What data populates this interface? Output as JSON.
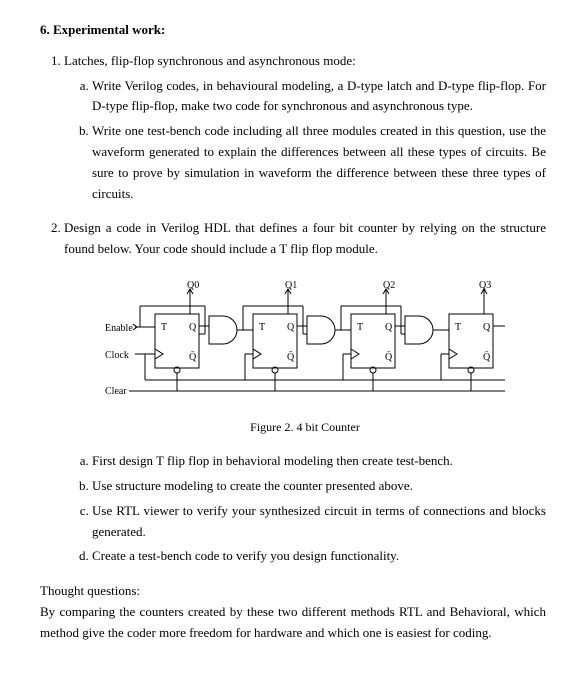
{
  "section": {
    "number": "6.",
    "title": "Experimental work:"
  },
  "q1": {
    "text": "Latches, flip-flop synchronous and asynchronous mode:",
    "a": "Write Verilog codes, in behavioural modeling, a D-type latch and D-type flip-flop. For D-type flip-flop, make two code for synchronous and asynchronous type.",
    "b": "Write one test-bench code including all three modules created in this question, use the waveform generated to explain the differences between all these types of circuits. Be sure to prove by simulation in waveform the difference between these three types of circuits."
  },
  "q2": {
    "text": "Design a code in Verilog HDL that defines a four bit counter by relying on the structure found below. Your code should include a T flip flop module.",
    "caption": "Figure 2. 4 bit Counter",
    "a": "First design T flip flop in behavioral modeling then create test-bench.",
    "b": "Use structure modeling to create the counter presented above.",
    "c": "Use RTL viewer to verify your synthesized circuit in terms of connections and blocks generated.",
    "d": "Create a test-bench code to verify you design functionality."
  },
  "fig": {
    "enable": "Enable",
    "clock": "Clock",
    "clear": "Clear",
    "q0": "Q0",
    "q1": "Q1",
    "q2": "Q2",
    "q3": "Q3",
    "t": "T",
    "q": "Q",
    "qbar": "Q̄"
  },
  "thought": {
    "title": "Thought questions:",
    "body": "By comparing the counters created by these two different methods RTL and Behavioral, which method give the coder more freedom for hardware and which one is easiest for coding."
  }
}
